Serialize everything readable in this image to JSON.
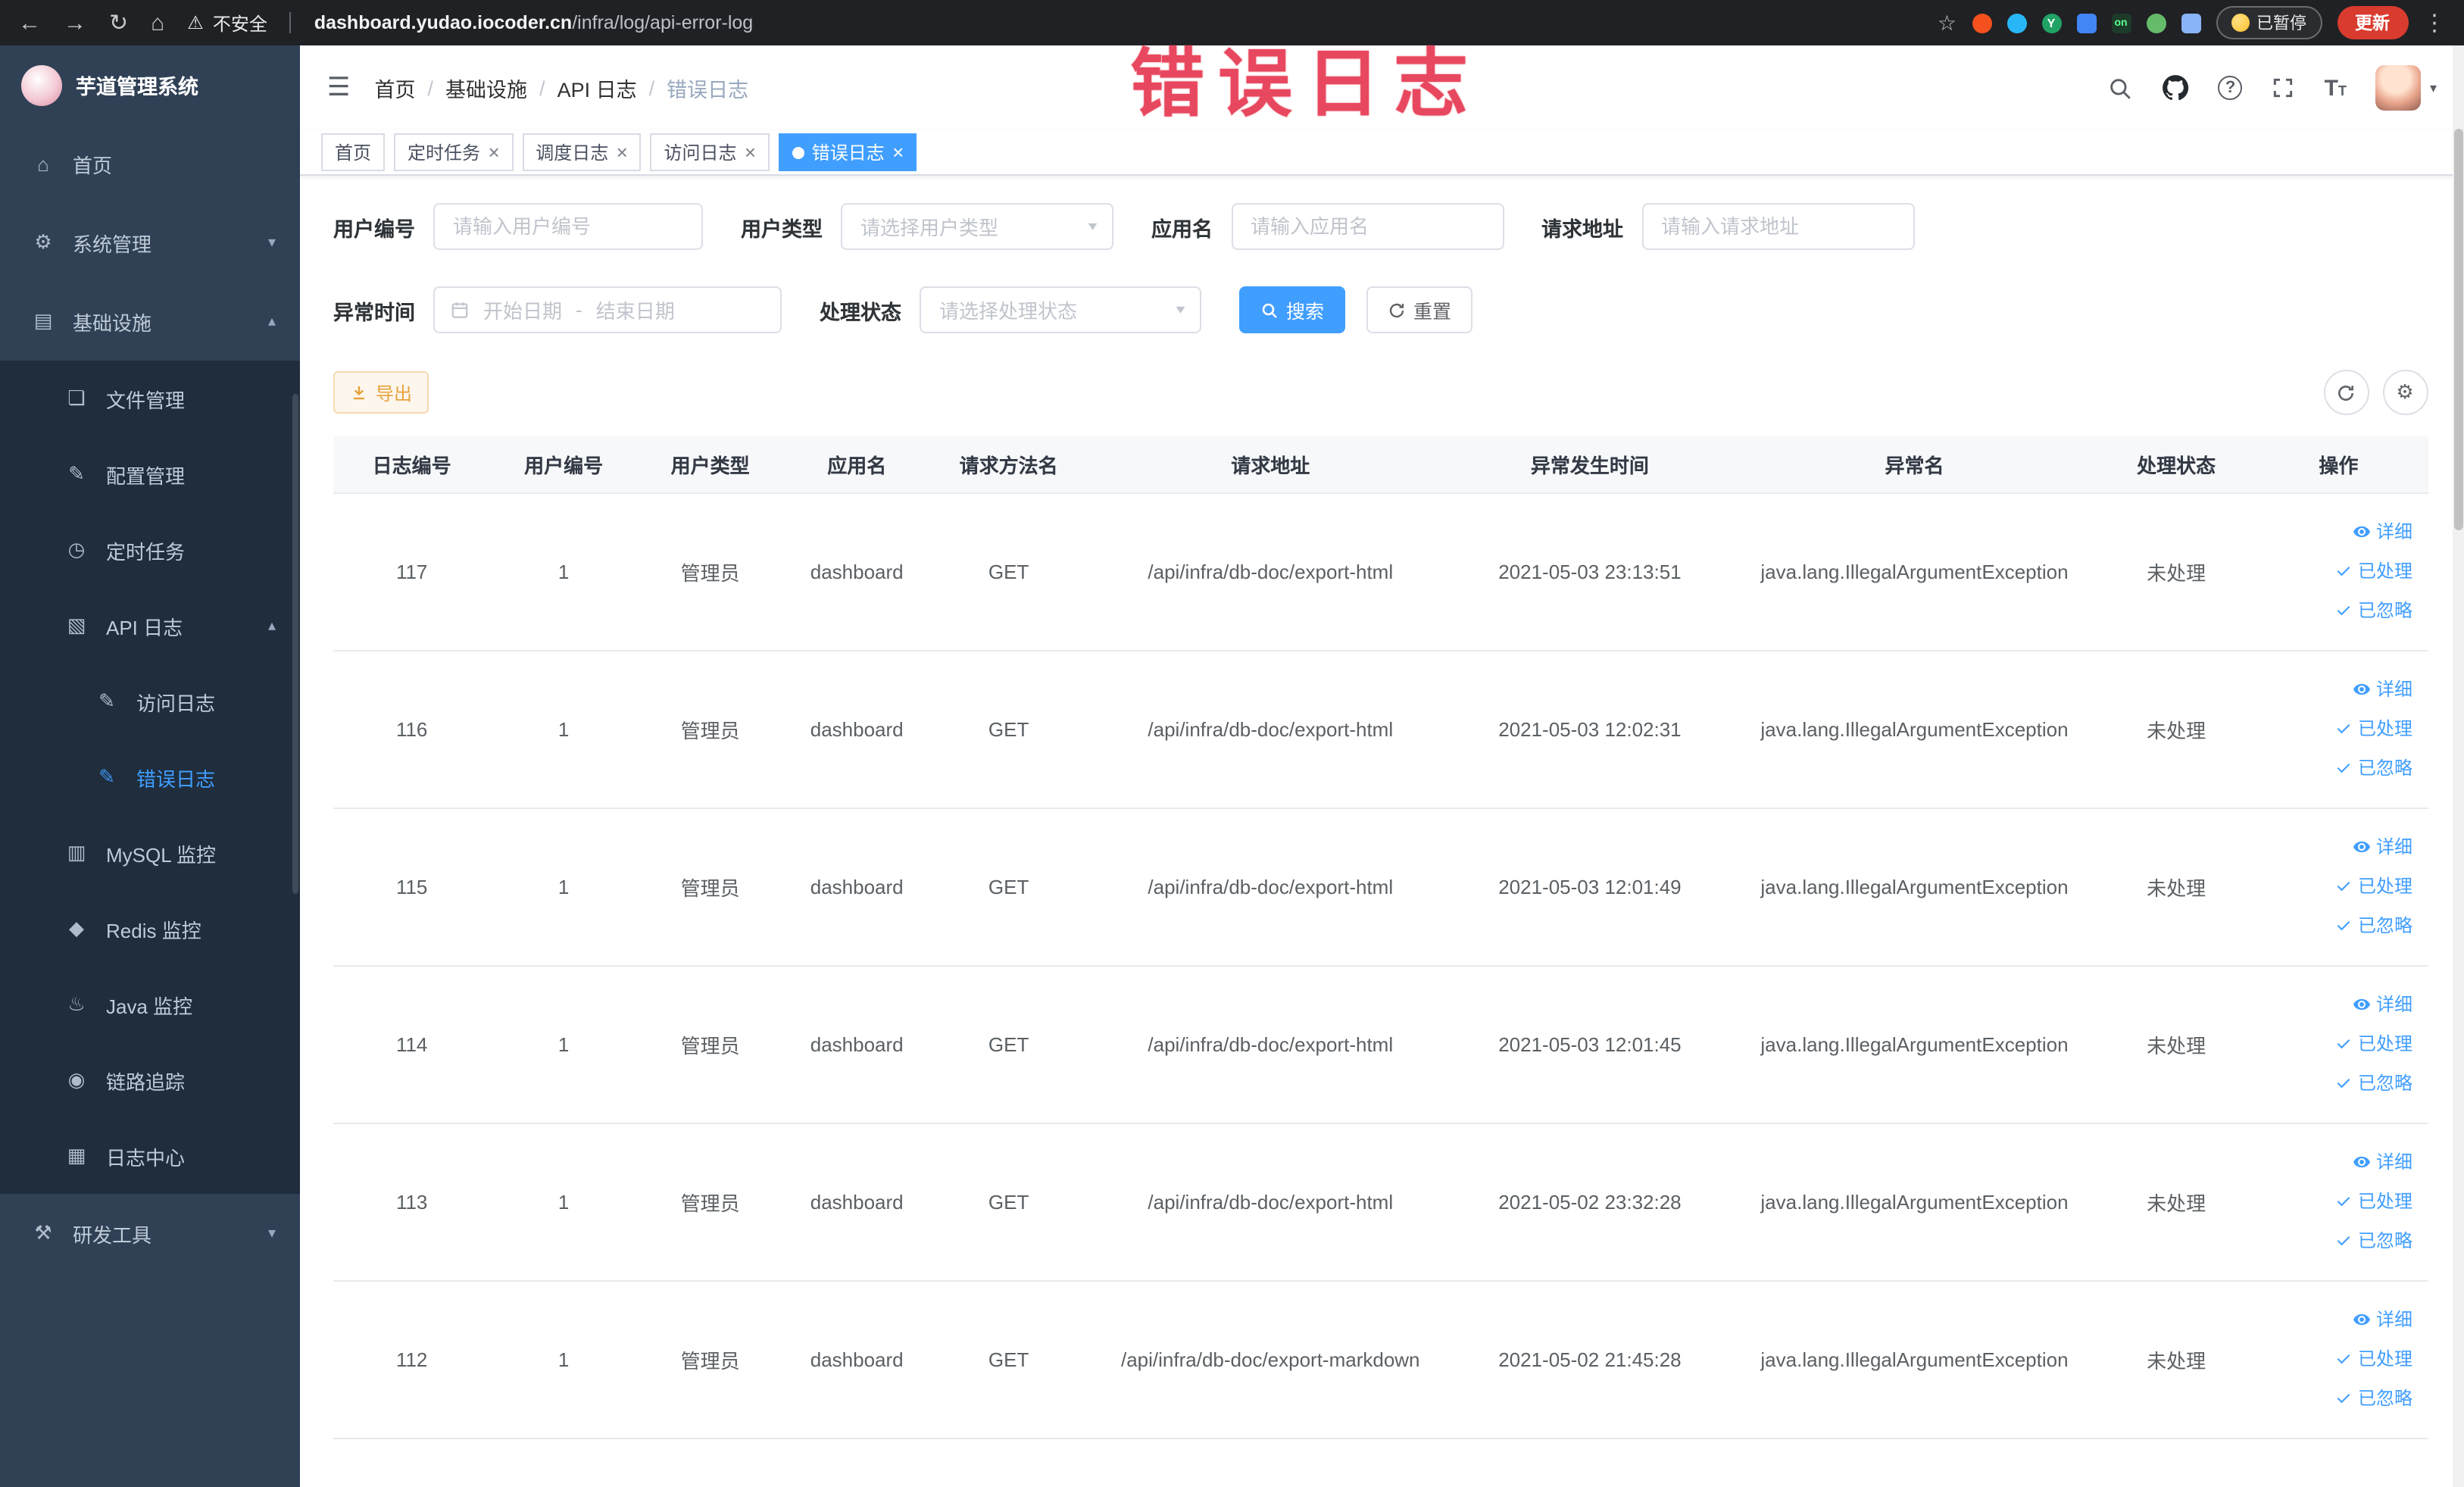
{
  "browser": {
    "security_label": "不安全",
    "url_host": "dashboard.yudao.iocoder.cn",
    "url_path": "/infra/log/api-error-log",
    "paused_badge": "已暂停",
    "update_button": "更新"
  },
  "sidebar": {
    "logo_title": "芋道管理系统",
    "items": [
      {
        "id": "home",
        "label": "首页",
        "icon": "home",
        "level": 1
      },
      {
        "id": "system-mgmt",
        "label": "系统管理",
        "icon": "gear",
        "level": 1,
        "arrow": "down"
      },
      {
        "id": "infrastructure",
        "label": "基础设施",
        "icon": "infra",
        "level": 1,
        "arrow": "up"
      },
      {
        "id": "file-mgmt",
        "label": "文件管理",
        "icon": "file",
        "level": 2
      },
      {
        "id": "config-mgmt",
        "label": "配置管理",
        "icon": "config",
        "level": 2
      },
      {
        "id": "cron-job",
        "label": "定时任务",
        "icon": "job",
        "level": 2
      },
      {
        "id": "api-log",
        "label": "API 日志",
        "icon": "api-log",
        "level": 2,
        "arrow": "up"
      },
      {
        "id": "access-log",
        "label": "访问日志",
        "icon": "access-log",
        "level": 3
      },
      {
        "id": "error-log",
        "label": "错误日志",
        "icon": "error-log",
        "level": 3,
        "active": true
      },
      {
        "id": "mysql-monitor",
        "label": "MySQL 监控",
        "icon": "mysql",
        "level": 2
      },
      {
        "id": "redis-monitor",
        "label": "Redis 监控",
        "icon": "redis",
        "level": 2
      },
      {
        "id": "java-monitor",
        "label": "Java 监控",
        "icon": "java",
        "level": 2
      },
      {
        "id": "link-trace",
        "label": "链路追踪",
        "icon": "trace",
        "level": 2
      },
      {
        "id": "log-center",
        "label": "日志中心",
        "icon": "log-center",
        "level": 2
      },
      {
        "id": "dev-tools",
        "label": "研发工具",
        "icon": "devtools",
        "level": 1,
        "arrow": "down"
      }
    ]
  },
  "navbar": {
    "breadcrumb": [
      "首页",
      "基础设施",
      "API 日志",
      "错误日志"
    ]
  },
  "annotation": "错误日志",
  "tabs": [
    {
      "id": "home",
      "label": "首页",
      "closable": false,
      "active": false
    },
    {
      "id": "cron-job",
      "label": "定时任务",
      "closable": true,
      "active": false
    },
    {
      "id": "job-log",
      "label": "调度日志",
      "closable": true,
      "active": false
    },
    {
      "id": "access-log",
      "label": "访问日志",
      "closable": true,
      "active": false
    },
    {
      "id": "error-log",
      "label": "错误日志",
      "closable": true,
      "active": true
    }
  ],
  "filters": {
    "user_id": {
      "label": "用户编号",
      "placeholder": "请输入用户编号"
    },
    "user_type": {
      "label": "用户类型",
      "placeholder": "请选择用户类型"
    },
    "app_name": {
      "label": "应用名",
      "placeholder": "请输入应用名"
    },
    "request_url": {
      "label": "请求地址",
      "placeholder": "请输入请求地址"
    },
    "exception_time": {
      "label": "异常时间",
      "start_placeholder": "开始日期",
      "separator": "-",
      "end_placeholder": "结束日期"
    },
    "process_status": {
      "label": "处理状态",
      "placeholder": "请选择处理状态"
    },
    "search_button": "搜索",
    "reset_button": "重置"
  },
  "toolbar": {
    "export_label": "导出"
  },
  "table": {
    "columns": [
      "日志编号",
      "用户编号",
      "用户类型",
      "应用名",
      "请求方法名",
      "请求地址",
      "异常发生时间",
      "异常名",
      "处理状态",
      "操作"
    ],
    "actions": {
      "detail": "详细",
      "processed": "已处理",
      "ignored": "已忽略"
    },
    "rows": [
      {
        "log_id": "117",
        "user_id": "1",
        "user_type": "管理员",
        "app_name": "dashboard",
        "method": "GET",
        "url": "/api/infra/db-doc/export-html",
        "time": "2021-05-03 23:13:51",
        "exception": "java.lang.IllegalArgumentException",
        "status": "未处理"
      },
      {
        "log_id": "116",
        "user_id": "1",
        "user_type": "管理员",
        "app_name": "dashboard",
        "method": "GET",
        "url": "/api/infra/db-doc/export-html",
        "time": "2021-05-03 12:02:31",
        "exception": "java.lang.IllegalArgumentException",
        "status": "未处理"
      },
      {
        "log_id": "115",
        "user_id": "1",
        "user_type": "管理员",
        "app_name": "dashboard",
        "method": "GET",
        "url": "/api/infra/db-doc/export-html",
        "time": "2021-05-03 12:01:49",
        "exception": "java.lang.IllegalArgumentException",
        "status": "未处理"
      },
      {
        "log_id": "114",
        "user_id": "1",
        "user_type": "管理员",
        "app_name": "dashboard",
        "method": "GET",
        "url": "/api/infra/db-doc/export-html",
        "time": "2021-05-03 12:01:45",
        "exception": "java.lang.IllegalArgumentException",
        "status": "未处理"
      },
      {
        "log_id": "113",
        "user_id": "1",
        "user_type": "管理员",
        "app_name": "dashboard",
        "method": "GET",
        "url": "/api/infra/db-doc/export-html",
        "time": "2021-05-02 23:32:28",
        "exception": "java.lang.IllegalArgumentException",
        "status": "未处理"
      },
      {
        "log_id": "112",
        "user_id": "1",
        "user_type": "管理员",
        "app_name": "dashboard",
        "method": "GET",
        "url": "/api/infra/db-doc/export-markdown",
        "time": "2021-05-02 21:45:28",
        "exception": "java.lang.IllegalArgumentException",
        "status": "未处理"
      }
    ]
  },
  "icons": {
    "home": "⌂",
    "gear": "⚙",
    "infra": "▤",
    "file": "❏",
    "config": "✎",
    "job": "◷",
    "api-log": "▧",
    "access-log": "✎",
    "error-log": "✎",
    "mysql": "▥",
    "redis": "◆",
    "java": "♨",
    "trace": "◉",
    "log-center": "▦",
    "devtools": "⚒",
    "hamburger": "☰",
    "back": "←",
    "forward": "→",
    "reload": "↻",
    "chrome-home": "⌂",
    "warning": "⚠",
    "star": "☆",
    "kebab": "⋮",
    "caret-down": "▼",
    "chevron-up": "▴",
    "chevron-down": "▾",
    "close": "×",
    "question": "?"
  },
  "colors": {
    "primary": "#409eff",
    "warning": "#e6a23c",
    "sidebar_bg": "#304156",
    "submenu_bg": "#1f2d3d",
    "annotation": "#e8485f"
  }
}
